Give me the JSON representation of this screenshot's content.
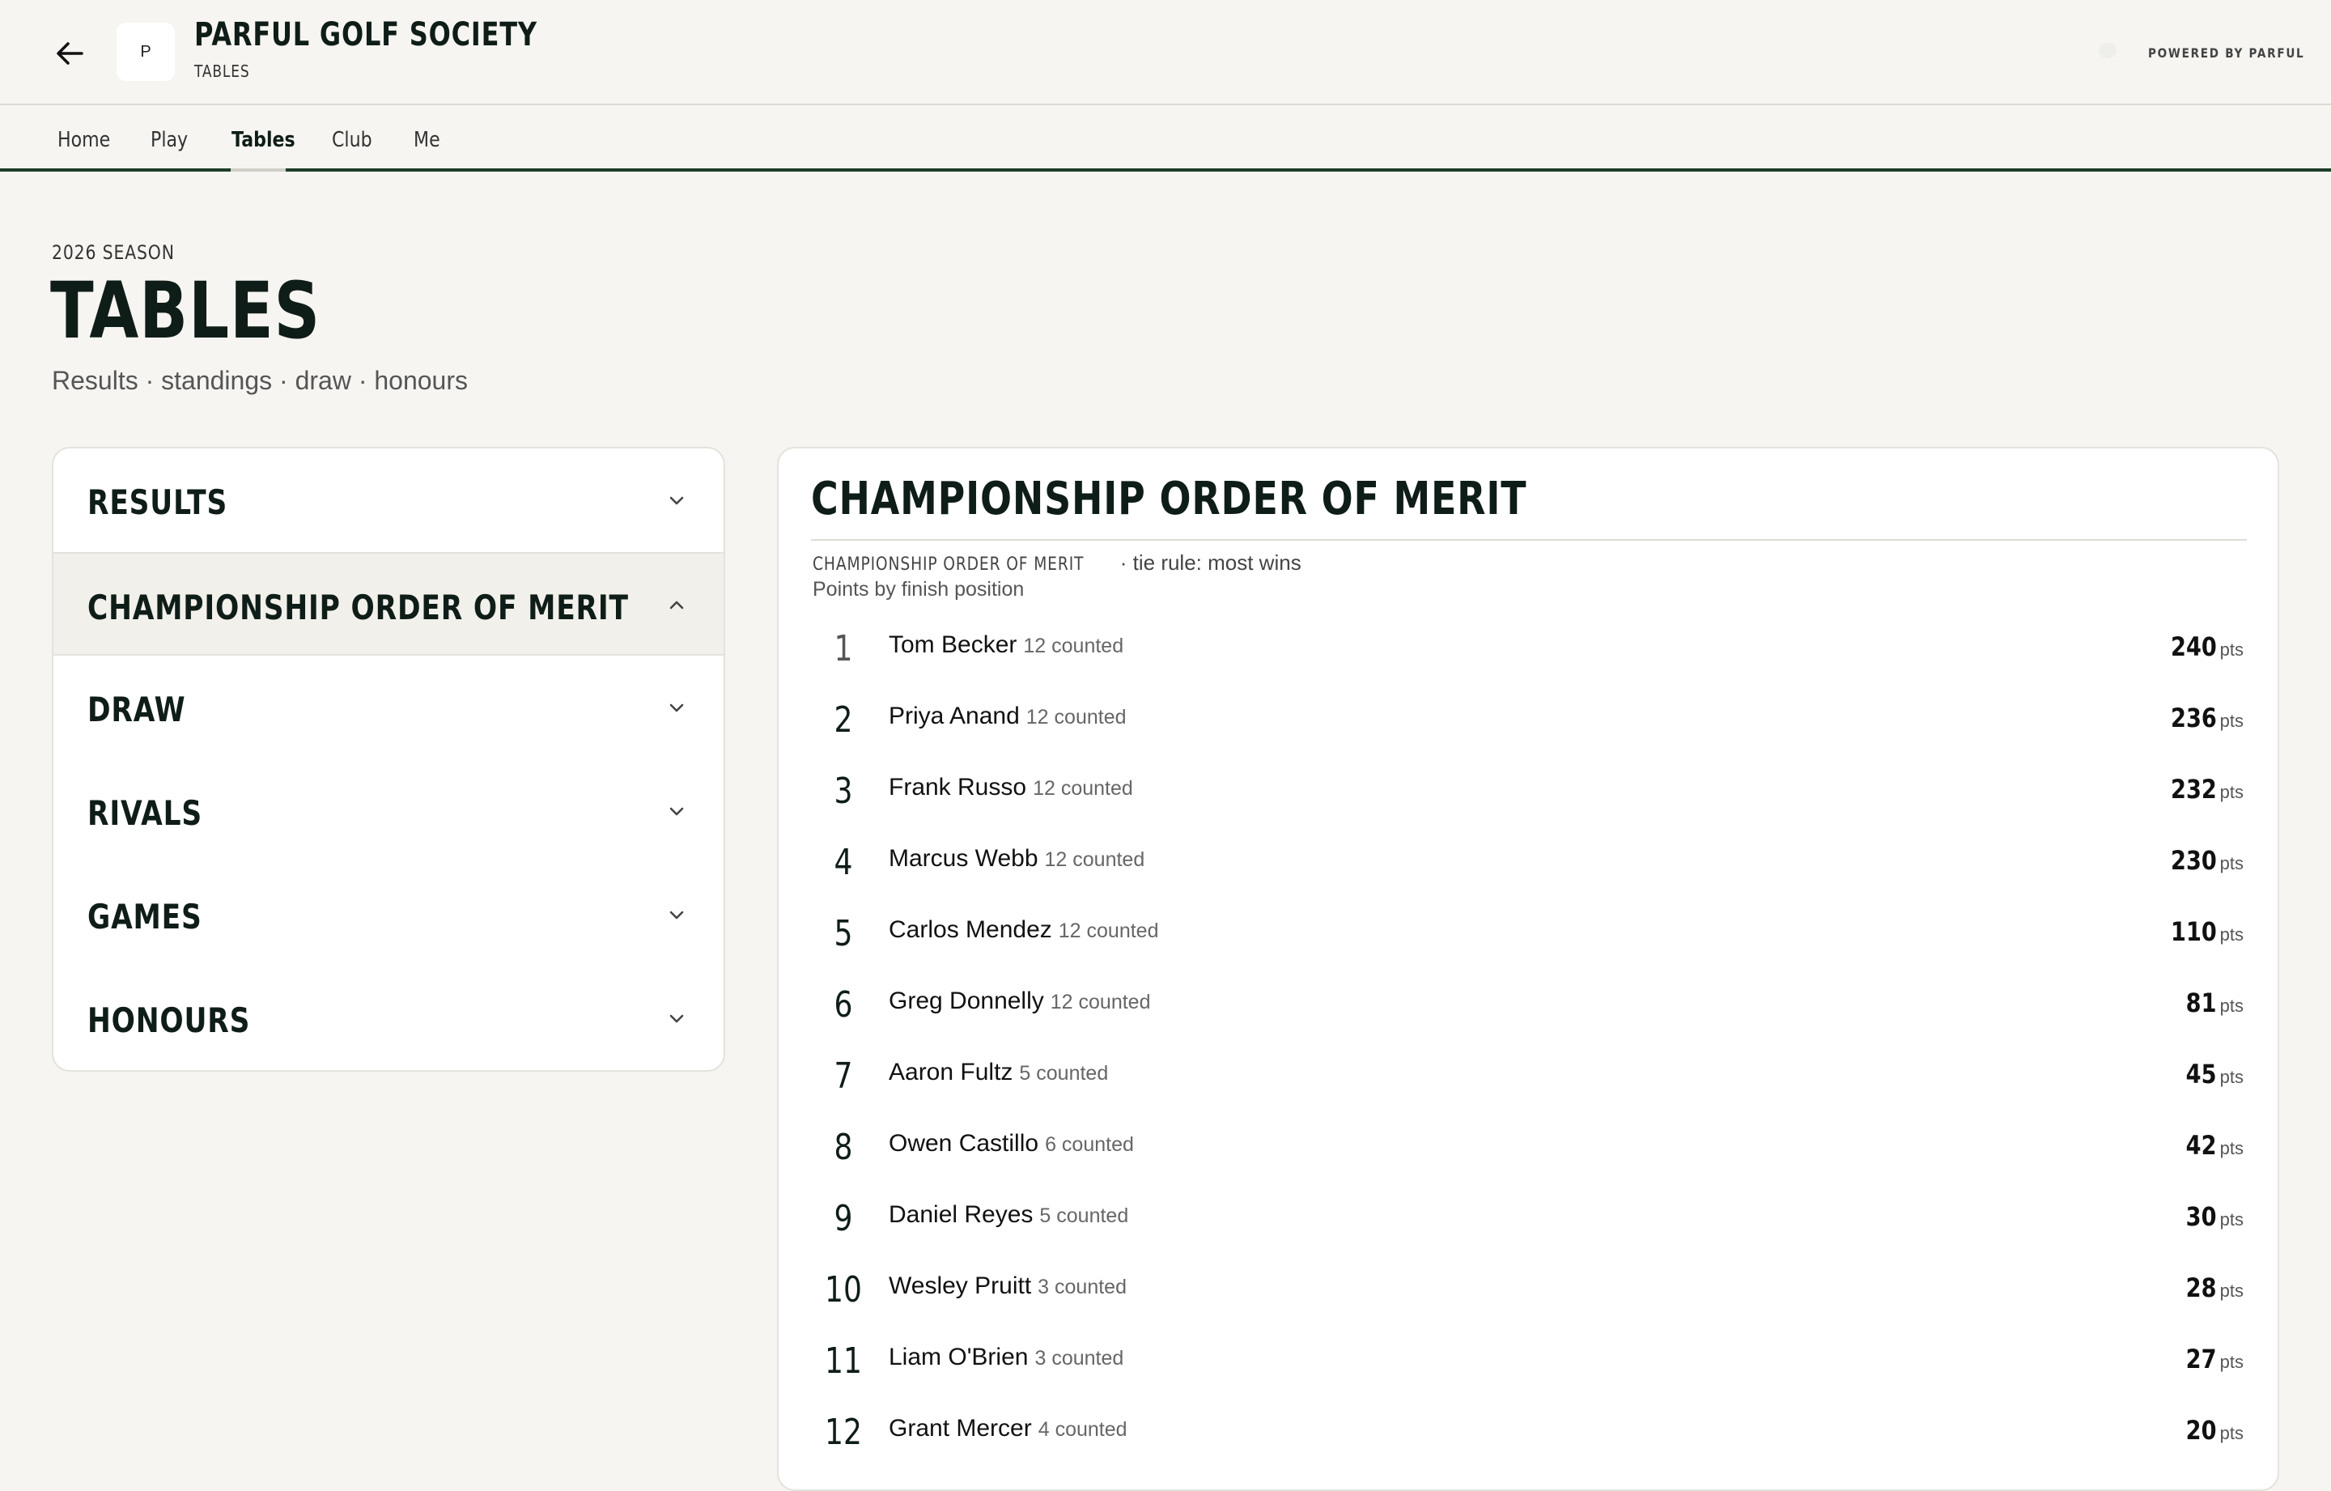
{
  "header": {
    "logo_letter": "P",
    "title": "PARFUL GOLF SOCIETY",
    "subtitle": "TABLES",
    "powered_by": "POWERED BY PARFUL"
  },
  "nav": {
    "tabs": [
      {
        "label": "Home"
      },
      {
        "label": "Play"
      },
      {
        "label": "Tables"
      },
      {
        "label": "Club"
      },
      {
        "label": "Me"
      }
    ],
    "active": "Tables"
  },
  "page": {
    "season": "2026 SEASON",
    "title": "TABLES",
    "subtitle": "Results · standings · draw · honours"
  },
  "sections": [
    {
      "label": "RESULTS",
      "open": false
    },
    {
      "label": "CHAMPIONSHIP ORDER OF MERIT",
      "open": true
    },
    {
      "label": "DRAW",
      "open": false
    },
    {
      "label": "RIVALS",
      "open": false
    },
    {
      "label": "GAMES",
      "open": false
    },
    {
      "label": "HONOURS",
      "open": false
    }
  ],
  "standings": {
    "title": "CHAMPIONSHIP ORDER OF MERIT",
    "meta_caption": "CHAMPIONSHIP ORDER OF MERIT",
    "meta_rule": "· tie rule: most wins",
    "meta_note": "Points by finish position",
    "points_unit": "pts",
    "rows": [
      {
        "rank": "1",
        "name": "Tom Becker",
        "counted": "12 counted",
        "points": "240"
      },
      {
        "rank": "2",
        "name": "Priya Anand",
        "counted": "12 counted",
        "points": "236"
      },
      {
        "rank": "3",
        "name": "Frank Russo",
        "counted": "12 counted",
        "points": "232"
      },
      {
        "rank": "4",
        "name": "Marcus Webb",
        "counted": "12 counted",
        "points": "230"
      },
      {
        "rank": "5",
        "name": "Carlos Mendez",
        "counted": "12 counted",
        "points": "110"
      },
      {
        "rank": "6",
        "name": "Greg Donnelly",
        "counted": "12 counted",
        "points": "81"
      },
      {
        "rank": "7",
        "name": "Aaron Fultz",
        "counted": "5 counted",
        "points": "45"
      },
      {
        "rank": "8",
        "name": "Owen Castillo",
        "counted": "6 counted",
        "points": "42"
      },
      {
        "rank": "9",
        "name": "Daniel Reyes",
        "counted": "5 counted",
        "points": "30"
      },
      {
        "rank": "10",
        "name": "Wesley Pruitt",
        "counted": "3 counted",
        "points": "28"
      },
      {
        "rank": "11",
        "name": "Liam O'Brien",
        "counted": "3 counted",
        "points": "27"
      },
      {
        "rank": "12",
        "name": "Grant Mercer",
        "counted": "4 counted",
        "points": "20"
      }
    ]
  },
  "colors": {
    "background": "#f6f5f1",
    "text": "#0f1d18",
    "nav_rule": "#1e3d2a",
    "card": "#ffffff"
  }
}
